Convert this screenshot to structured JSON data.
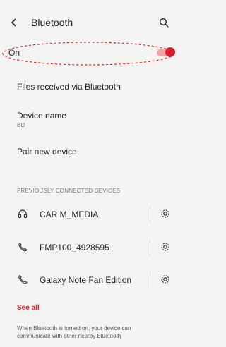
{
  "header": {
    "title": "Bluetooth",
    "back_icon": "chevron-left-icon",
    "search_icon": "search-icon"
  },
  "bluetooth_toggle": {
    "label": "On",
    "state": "on",
    "accent_color": "#d6202f"
  },
  "menu": {
    "files_received": "Files received via Bluetooth",
    "device_name_label": "Device name",
    "device_name_value": "BU",
    "pair_new_device": "Pair new device"
  },
  "previous_devices": {
    "section_title": "PREVIOUSLY CONNECTED DEVICES",
    "items": [
      {
        "name": "CAR M_MEDIA",
        "icon": "headphones-icon"
      },
      {
        "name": "FMP100_4928595",
        "icon": "phone-icon"
      },
      {
        "name": "Galaxy Note Fan Edition",
        "icon": "phone-icon"
      }
    ]
  },
  "see_all": "See all",
  "footer": "When Bluetooth is turned on, your device can communicate with other nearby Bluetooth"
}
